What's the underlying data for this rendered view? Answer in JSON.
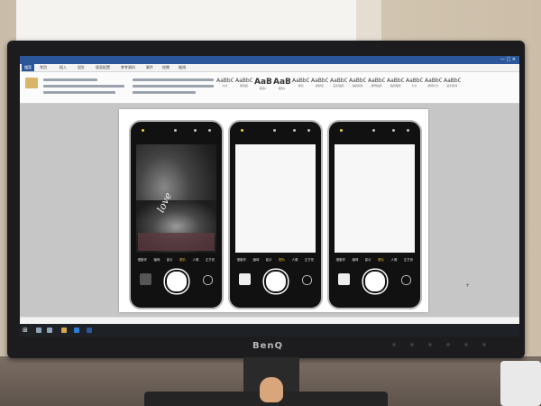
{
  "monitor": {
    "brand": "BenQ"
  },
  "word": {
    "window_controls": "— □ ✕",
    "file_tab": "檔案",
    "tabs": [
      "常用",
      "插入",
      "設計",
      "版面配置",
      "參考資料",
      "郵件",
      "校閱",
      "檢視"
    ],
    "styles": [
      {
        "sample": "AaBbCcD",
        "name": "內文"
      },
      {
        "sample": "AaBbCcD",
        "name": "無間距"
      },
      {
        "sample": "AaB",
        "name": "標題1"
      },
      {
        "sample": "AaB",
        "name": "標題2"
      },
      {
        "sample": "AaBbC",
        "name": "標題"
      },
      {
        "sample": "AaBbCcD",
        "name": "副標題"
      },
      {
        "sample": "AaBbCcD",
        "name": "區別強調"
      },
      {
        "sample": "AaBbCcD",
        "name": "強調斜體"
      },
      {
        "sample": "AaBbCcD",
        "name": "鮮明強調"
      },
      {
        "sample": "AaBbCcD",
        "name": "強調粗體"
      },
      {
        "sample": "AaBbCcD",
        "name": "引文"
      },
      {
        "sample": "AaBbCcD",
        "name": "鮮明引文"
      },
      {
        "sample": "AaBbCcD",
        "name": "區別參考"
      }
    ]
  },
  "phones": [
    {
      "modes": [
        "慢動作",
        "縮時",
        "影片",
        "照片",
        "人像",
        "正方形"
      ],
      "active_mode": "照片",
      "preview": "ultrasound",
      "handwriting": "love"
    },
    {
      "modes": [
        "慢動作",
        "縮時",
        "影片",
        "照片",
        "人像",
        "正方形"
      ],
      "active_mode": "照片",
      "preview": "blank"
    },
    {
      "modes": [
        "慢動作",
        "縮時",
        "影片",
        "照片",
        "人像",
        "正方形"
      ],
      "active_mode": "照片",
      "preview": "blank"
    }
  ],
  "colors": {
    "word_blue": "#2b579a",
    "flash_yellow": "#e6d23a",
    "active_mode": "#f1c232"
  }
}
